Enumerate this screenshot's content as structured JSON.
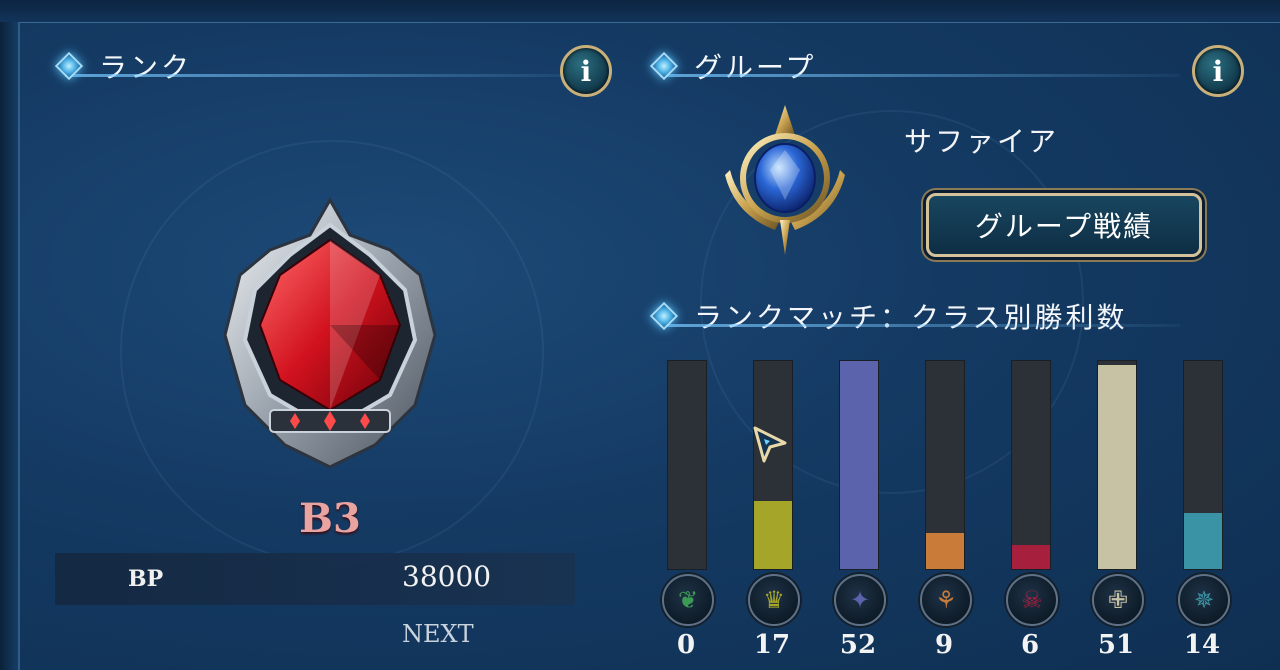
{
  "rank": {
    "section_title": "ランク",
    "info_label": "i",
    "rank_name": "B3",
    "bp_label": "BP",
    "bp_value": "38000",
    "next_label": "NEXT"
  },
  "group": {
    "section_title": "グループ",
    "info_label": "i",
    "group_name": "サファイア",
    "record_button": "グループ戦績"
  },
  "rankmatch": {
    "section_title": "ランクマッチ：クラス別勝利数"
  },
  "chart_data": {
    "type": "bar",
    "categories": [
      "elf-leaf-icon",
      "royal-crown-icon",
      "witch-circle-icon",
      "dragon-icon",
      "nightmare-icon",
      "bishop-icon",
      "nemesis-icon"
    ],
    "values": [
      0,
      17,
      52,
      9,
      6,
      51,
      14
    ],
    "ylim": [
      0,
      52
    ],
    "colors": [
      "#3d9a55",
      "#a5a52a",
      "#5b63ad",
      "#c97c3a",
      "#a6203e",
      "#c8c2a5",
      "#3a93a4"
    ],
    "grid": false
  },
  "colors": {
    "accent_gold": "#d4c39a",
    "rank_red": "#e9a3a0",
    "sapphire": "#2b67d6"
  }
}
